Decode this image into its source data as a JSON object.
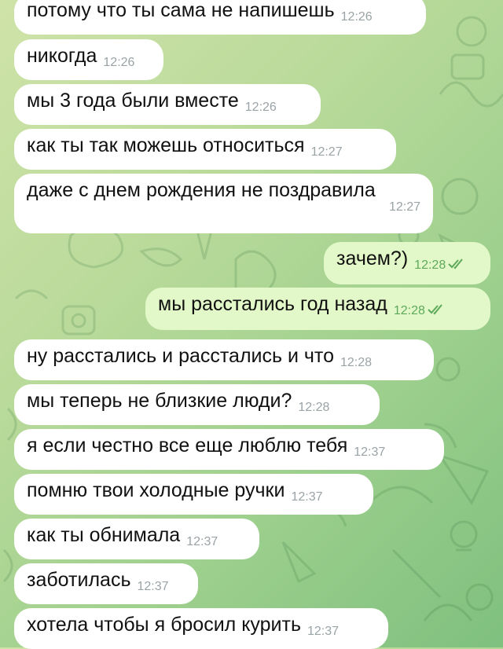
{
  "messages": [
    {
      "text": "потому что ты сама не напишешь",
      "time": "12:26",
      "dir": "in"
    },
    {
      "text": "никогда",
      "time": "12:26",
      "dir": "in"
    },
    {
      "text": "мы 3 года были вместе",
      "time": "12:26",
      "dir": "in"
    },
    {
      "text": "как ты так можешь относиться",
      "time": "12:27",
      "dir": "in"
    },
    {
      "text": "даже с днем рождения не поздравила",
      "time": "12:27",
      "dir": "in"
    },
    {
      "text": "зачем?)",
      "time": "12:28",
      "dir": "out"
    },
    {
      "text": "мы расстались год назад",
      "time": "12:28",
      "dir": "out"
    },
    {
      "text": "ну расстались и  расстались и что",
      "time": "12:28",
      "dir": "in"
    },
    {
      "text": "мы теперь не близкие люди?",
      "time": "12:28",
      "dir": "in"
    },
    {
      "text": "я если честно все еще  люблю тебя",
      "time": "12:37",
      "dir": "in"
    },
    {
      "text": "помню твои холодные ручки",
      "time": "12:37",
      "dir": "in"
    },
    {
      "text": "как  ты обнимала",
      "time": "12:37",
      "dir": "in"
    },
    {
      "text": "заботилась",
      "time": "12:37",
      "dir": "in"
    },
    {
      "text": "хотела чтобы я бросил курить",
      "time": "12:37",
      "dir": "in"
    }
  ],
  "colors": {
    "incoming": "#ffffff",
    "outgoing": "#e2f8c8",
    "time_in": "#9aa3a6",
    "time_out": "#5ea95c"
  },
  "icons": {
    "read_receipt": "double-check-icon"
  }
}
